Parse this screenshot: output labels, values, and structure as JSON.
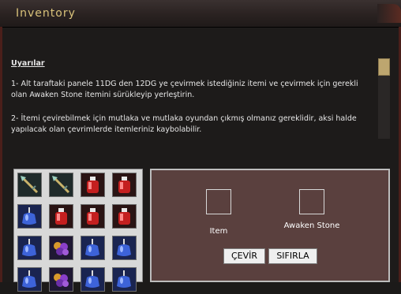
{
  "window": {
    "title": "Inventory"
  },
  "notice": {
    "heading": "Uyarılar",
    "paragraph1": "1- Alt taraftaki panele 11DG den 12DG ye çevirmek istediğiniz itemi ve çevirmek için gerekli olan Awaken Stone itemini sürükleyip yerleştirin.",
    "paragraph2": "2- İtemi çevirebilmek için mutlaka ve mutlaka oyundan çıkmış olmanız gereklidir, aksi halde yapılacak olan çevrimlerde itemleriniz kaybolabilir."
  },
  "inventory": {
    "rows": [
      [
        "spear-icon",
        "spear-icon",
        "red-potion-icon",
        "red-potion-icon"
      ],
      [
        "blue-potion-icon",
        "red-potion-icon",
        "red-potion-icon",
        "red-potion-icon"
      ],
      [
        "blue-potion-icon",
        "grape-icon",
        "blue-potion-icon",
        "blue-potion-icon"
      ],
      [
        "blue-potion-icon",
        "grape-icon",
        "blue-potion-icon",
        "blue-potion-icon"
      ]
    ]
  },
  "convert_panel": {
    "item_label": "Item",
    "stone_label": "Awaken Stone",
    "convert_button": "ÇEVİR",
    "reset_button": "SIFIRLA"
  },
  "colors": {
    "title": "#d9c27a",
    "panel_bg": "#5a403e",
    "scroll_thumb": "#bda66f"
  }
}
